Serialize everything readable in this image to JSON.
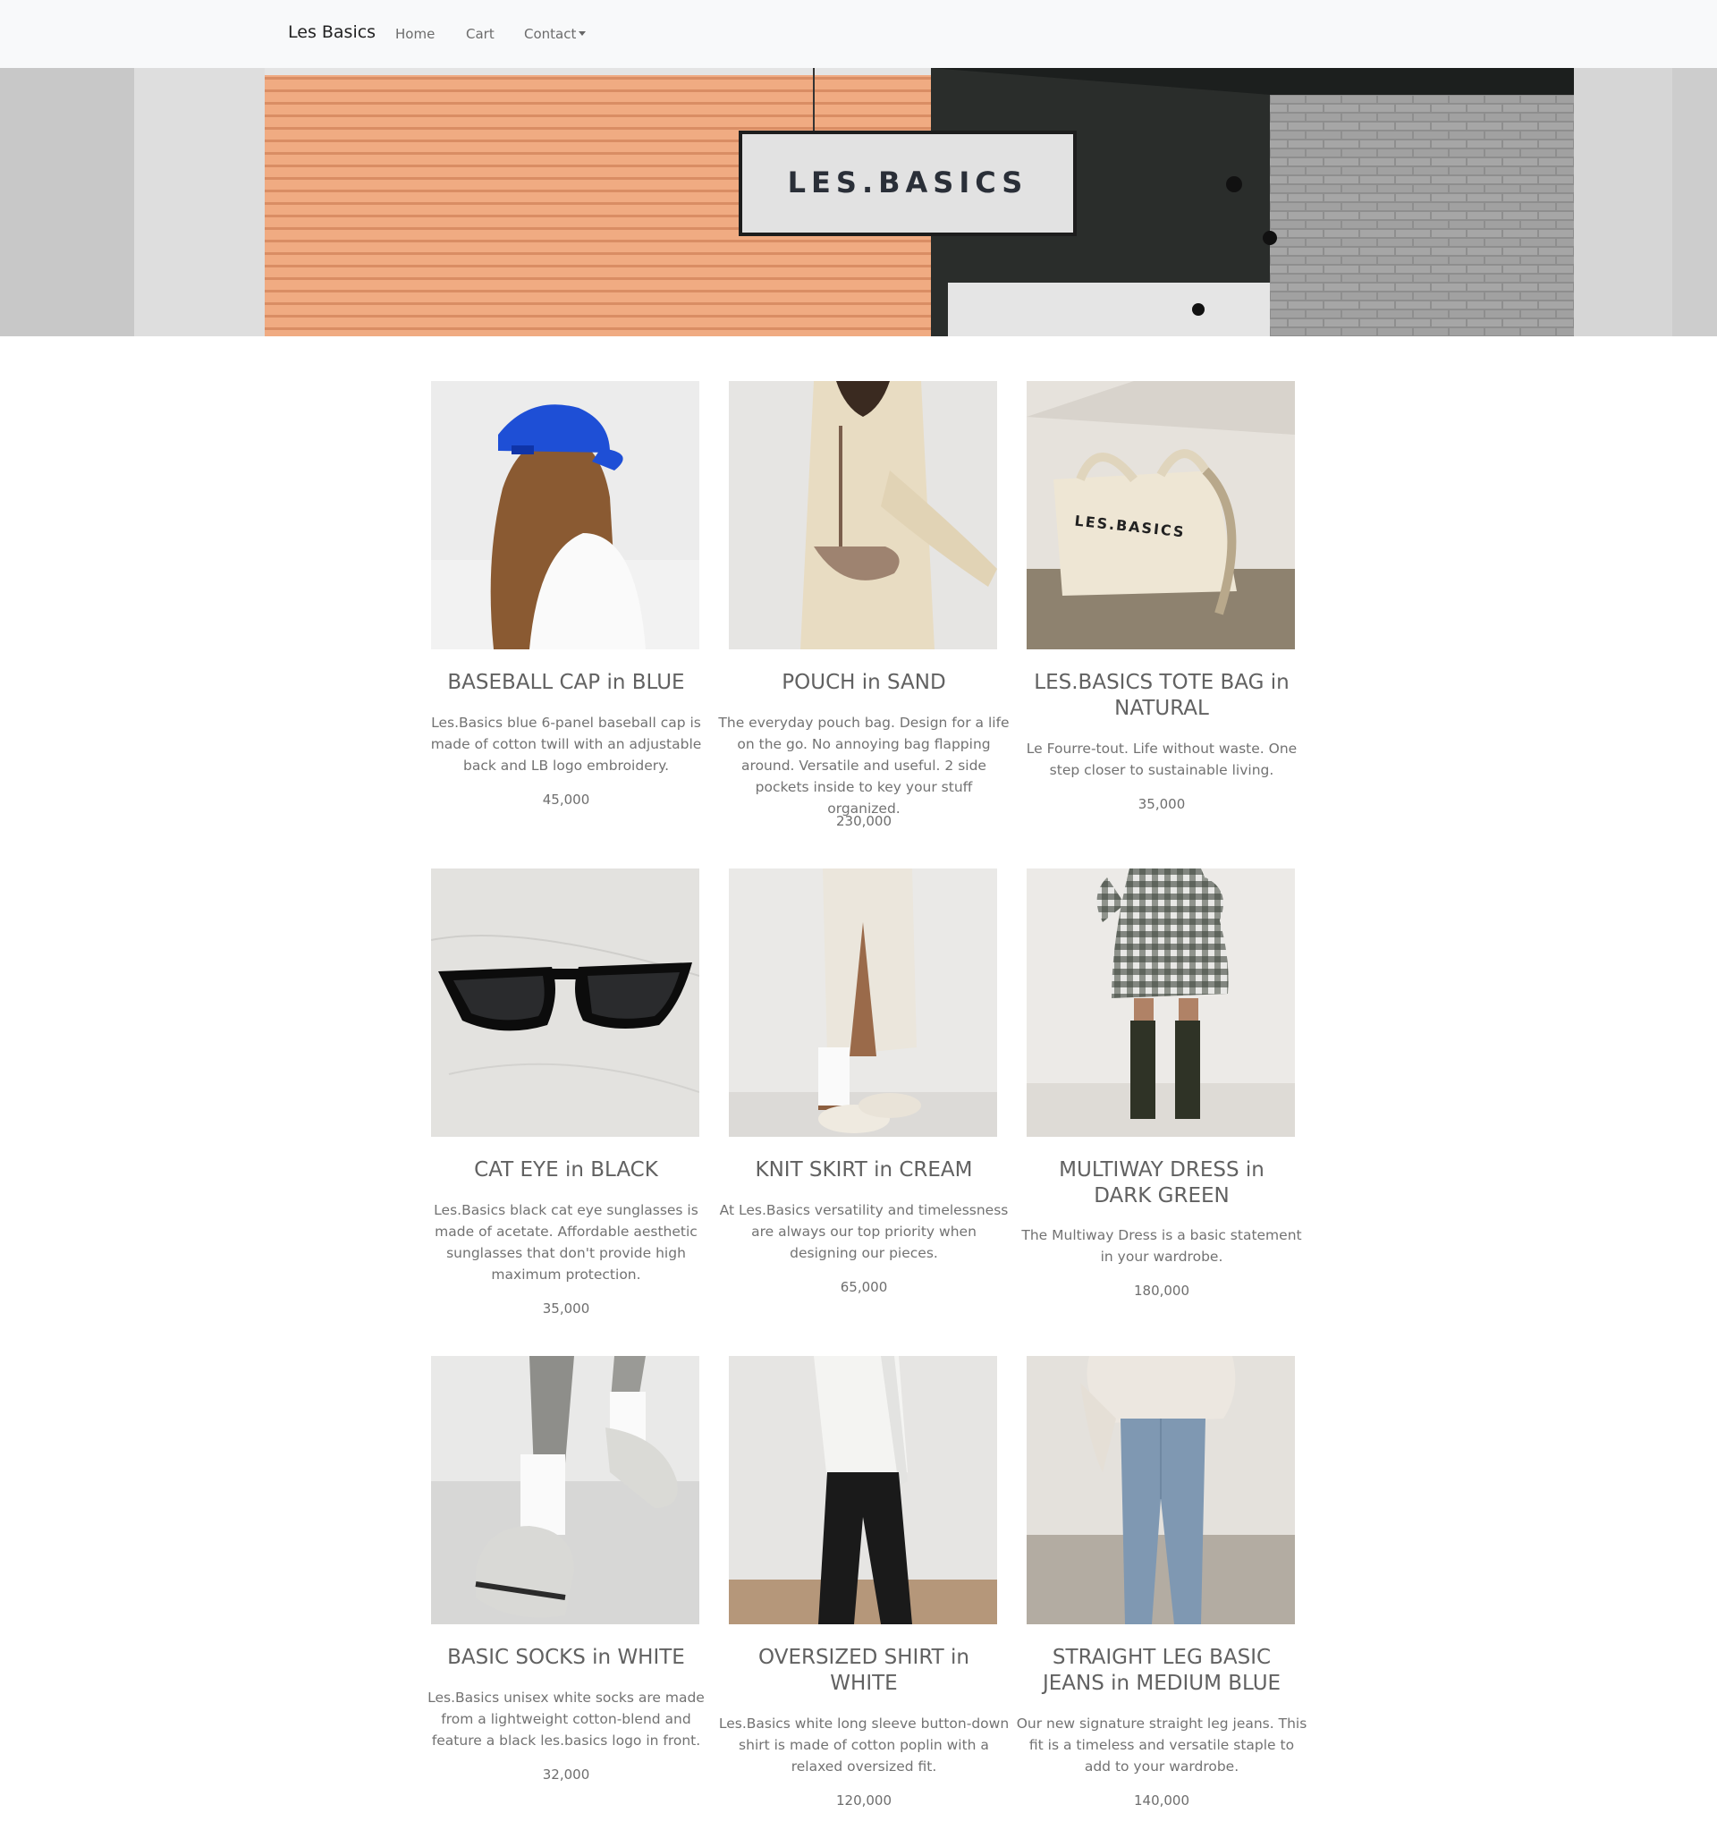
{
  "navbar": {
    "brand": "Les Basics",
    "links": {
      "home": "Home",
      "cart": "Cart",
      "contact": "Contact"
    }
  },
  "hero": {
    "sign_text": "LES.BASICS"
  },
  "products": [
    {
      "title": "BASEBALL CAP in BLUE",
      "description": "Les.Basics blue 6-panel baseball cap is made of cotton twill with an adjustable back and LB logo embroidery.",
      "price": "45,000"
    },
    {
      "title": "POUCH in SAND",
      "description": "The everyday pouch bag. Design for a life on the go. No annoying bag flapping around. Versatile and useful. 2 side pockets inside to key your stuff organized.",
      "price": "230,000"
    },
    {
      "title": "LES.BASICS TOTE BAG in NATURAL",
      "description": "Le Fourre-tout. Life without waste. One step closer to sustainable living.",
      "price": "35,000",
      "image_text": "LES.BASICS"
    },
    {
      "title": "CAT EYE in BLACK",
      "description": "Les.Basics black cat eye sunglasses is made of acetate. Affordable aesthetic sunglasses that don't provide high maximum protection.",
      "price": "35,000"
    },
    {
      "title": "KNIT SKIRT in CREAM",
      "description": "At Les.Basics versatility and timelessness are always our top priority when designing our pieces.",
      "price": "65,000"
    },
    {
      "title": "MULTIWAY DRESS in DARK GREEN",
      "description": "The Multiway Dress is a basic statement in your wardrobe.",
      "price": "180,000"
    },
    {
      "title": "BASIC SOCKS in WHITE",
      "description": "Les.Basics unisex white socks are made from a lightweight cotton-blend and feature a black les.basics logo in front.",
      "price": "32,000"
    },
    {
      "title": "OVERSIZED SHIRT in WHITE",
      "description": "Les.Basics white long sleeve button-down shirt is made of cotton poplin with a relaxed oversized fit.",
      "price": "120,000"
    },
    {
      "title": "STRAIGHT LEG BASIC JEANS in MEDIUM BLUE",
      "description": "Our new signature straight leg jeans. This fit is a timeless and versatile staple to add to your wardrobe.",
      "price": "140,000"
    }
  ]
}
